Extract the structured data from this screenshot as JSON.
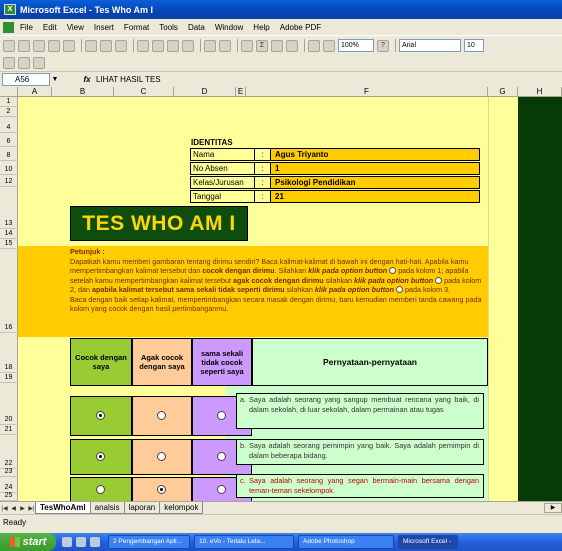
{
  "window": {
    "title": "Microsoft Excel - Tes Who Am I"
  },
  "menu": [
    "File",
    "Edit",
    "View",
    "Insert",
    "Format",
    "Tools",
    "Data",
    "Window",
    "Help",
    "Adobe PDF"
  ],
  "toolbar": {
    "zoom": "100%",
    "font": "Arial",
    "font_size": "10"
  },
  "formula_bar": {
    "cell_ref": "A56",
    "fx": "fx",
    "value": "LIHAT HASIL TES"
  },
  "columns": [
    "A",
    "B",
    "C",
    "D",
    "E",
    "F",
    "G",
    "H"
  ],
  "rows": [
    "1",
    "2",
    "4",
    "6",
    "8",
    "10",
    "12",
    "13",
    "14",
    "15",
    "16",
    "18",
    "19",
    "20",
    "21",
    "22",
    "23",
    "24",
    "25"
  ],
  "identitas": {
    "title": "IDENTITAS",
    "fields": [
      {
        "label": "Nama",
        "colon": ":",
        "value": "Agus Triyanto"
      },
      {
        "label": "No Absen",
        "colon": ":",
        "value": "1"
      },
      {
        "label": "Kelas/Jurusan",
        "colon": ":",
        "value": "Psikologi Pendidikan"
      },
      {
        "label": "Tanggal",
        "colon": ":",
        "value": "21"
      }
    ]
  },
  "banner": "TES WHO AM I",
  "petunjuk": {
    "heading": "Petunjuk :",
    "p1": "Dapatkah kamu memberi gambaran tentang dirimu sendiri? Baca kalimat-kalimat di bawah ini dengan hati-hati. Apabila kamu mempertimbangkan kalimat tersebut dan",
    "b1": "cocok dengan dirimu",
    "p2": ". Silahkan",
    "b2": "klik pada option button",
    "p3": "pada kolom 1; apabila setelah kamu mempertimbangkan kalimat tersebut",
    "b3": "agak cocok dengan dirimu",
    "p4": "silahkan",
    "b4": "klik pada option button",
    "p5": "pada kolom 2, dan",
    "b5": "apabila kalimat tersebut sama sekali tidak seperti dirimu",
    "p6": "silahkan",
    "b6": "klik pada option button",
    "p7": "pada kolom 3.",
    "p8": "Baca dengan baik setiap kalimat, mempertimbangkan secara masak dengan dirimu, baru kemudian memberi tanda cawang pada kolom yang cocok dengan hasil pertimbanganmu."
  },
  "questions_header": {
    "col1": "Cocok dengan saya",
    "col2": "Agak cocok dengan saya",
    "col3": "sama sekali tidak cocok seperti saya",
    "statements": "Pernyataan-pernyataan"
  },
  "questions": [
    {
      "label": "a.",
      "text": "Saya adalah seorang yang sangup membuat rencana yang baik, di dalam sekolah, di luar sekolah, dalam permainan atau tugas",
      "selected": 1
    },
    {
      "label": "b.",
      "text": "Saya adalah seorang pemimpin yang baik. Saya adalah pemimpin di dalam beberapa bidang.",
      "selected": 1
    },
    {
      "label": "c.",
      "text": "Saya adalah seorang yang segan bermain-main bersama dengan teman-teman sekelompok.",
      "selected": 2
    }
  ],
  "colors": {
    "col1": "#99cc33",
    "col2": "#ffcc99",
    "col3": "#cc99ff",
    "statement_bg": "#ccffcc",
    "banner_bg": "#0f4d0f",
    "banner_text": "#ffd700"
  },
  "sheet_tabs": [
    "TesWhoAmI",
    "analsis",
    "laporan",
    "kelompok"
  ],
  "status": "Ready",
  "taskbar": {
    "start": "start",
    "tasks": [
      "2 Pengembangan Apli...",
      "10. eVo - Terlalu Lela...",
      "Adobe Photoshop",
      "Microsoft Excel -"
    ]
  }
}
